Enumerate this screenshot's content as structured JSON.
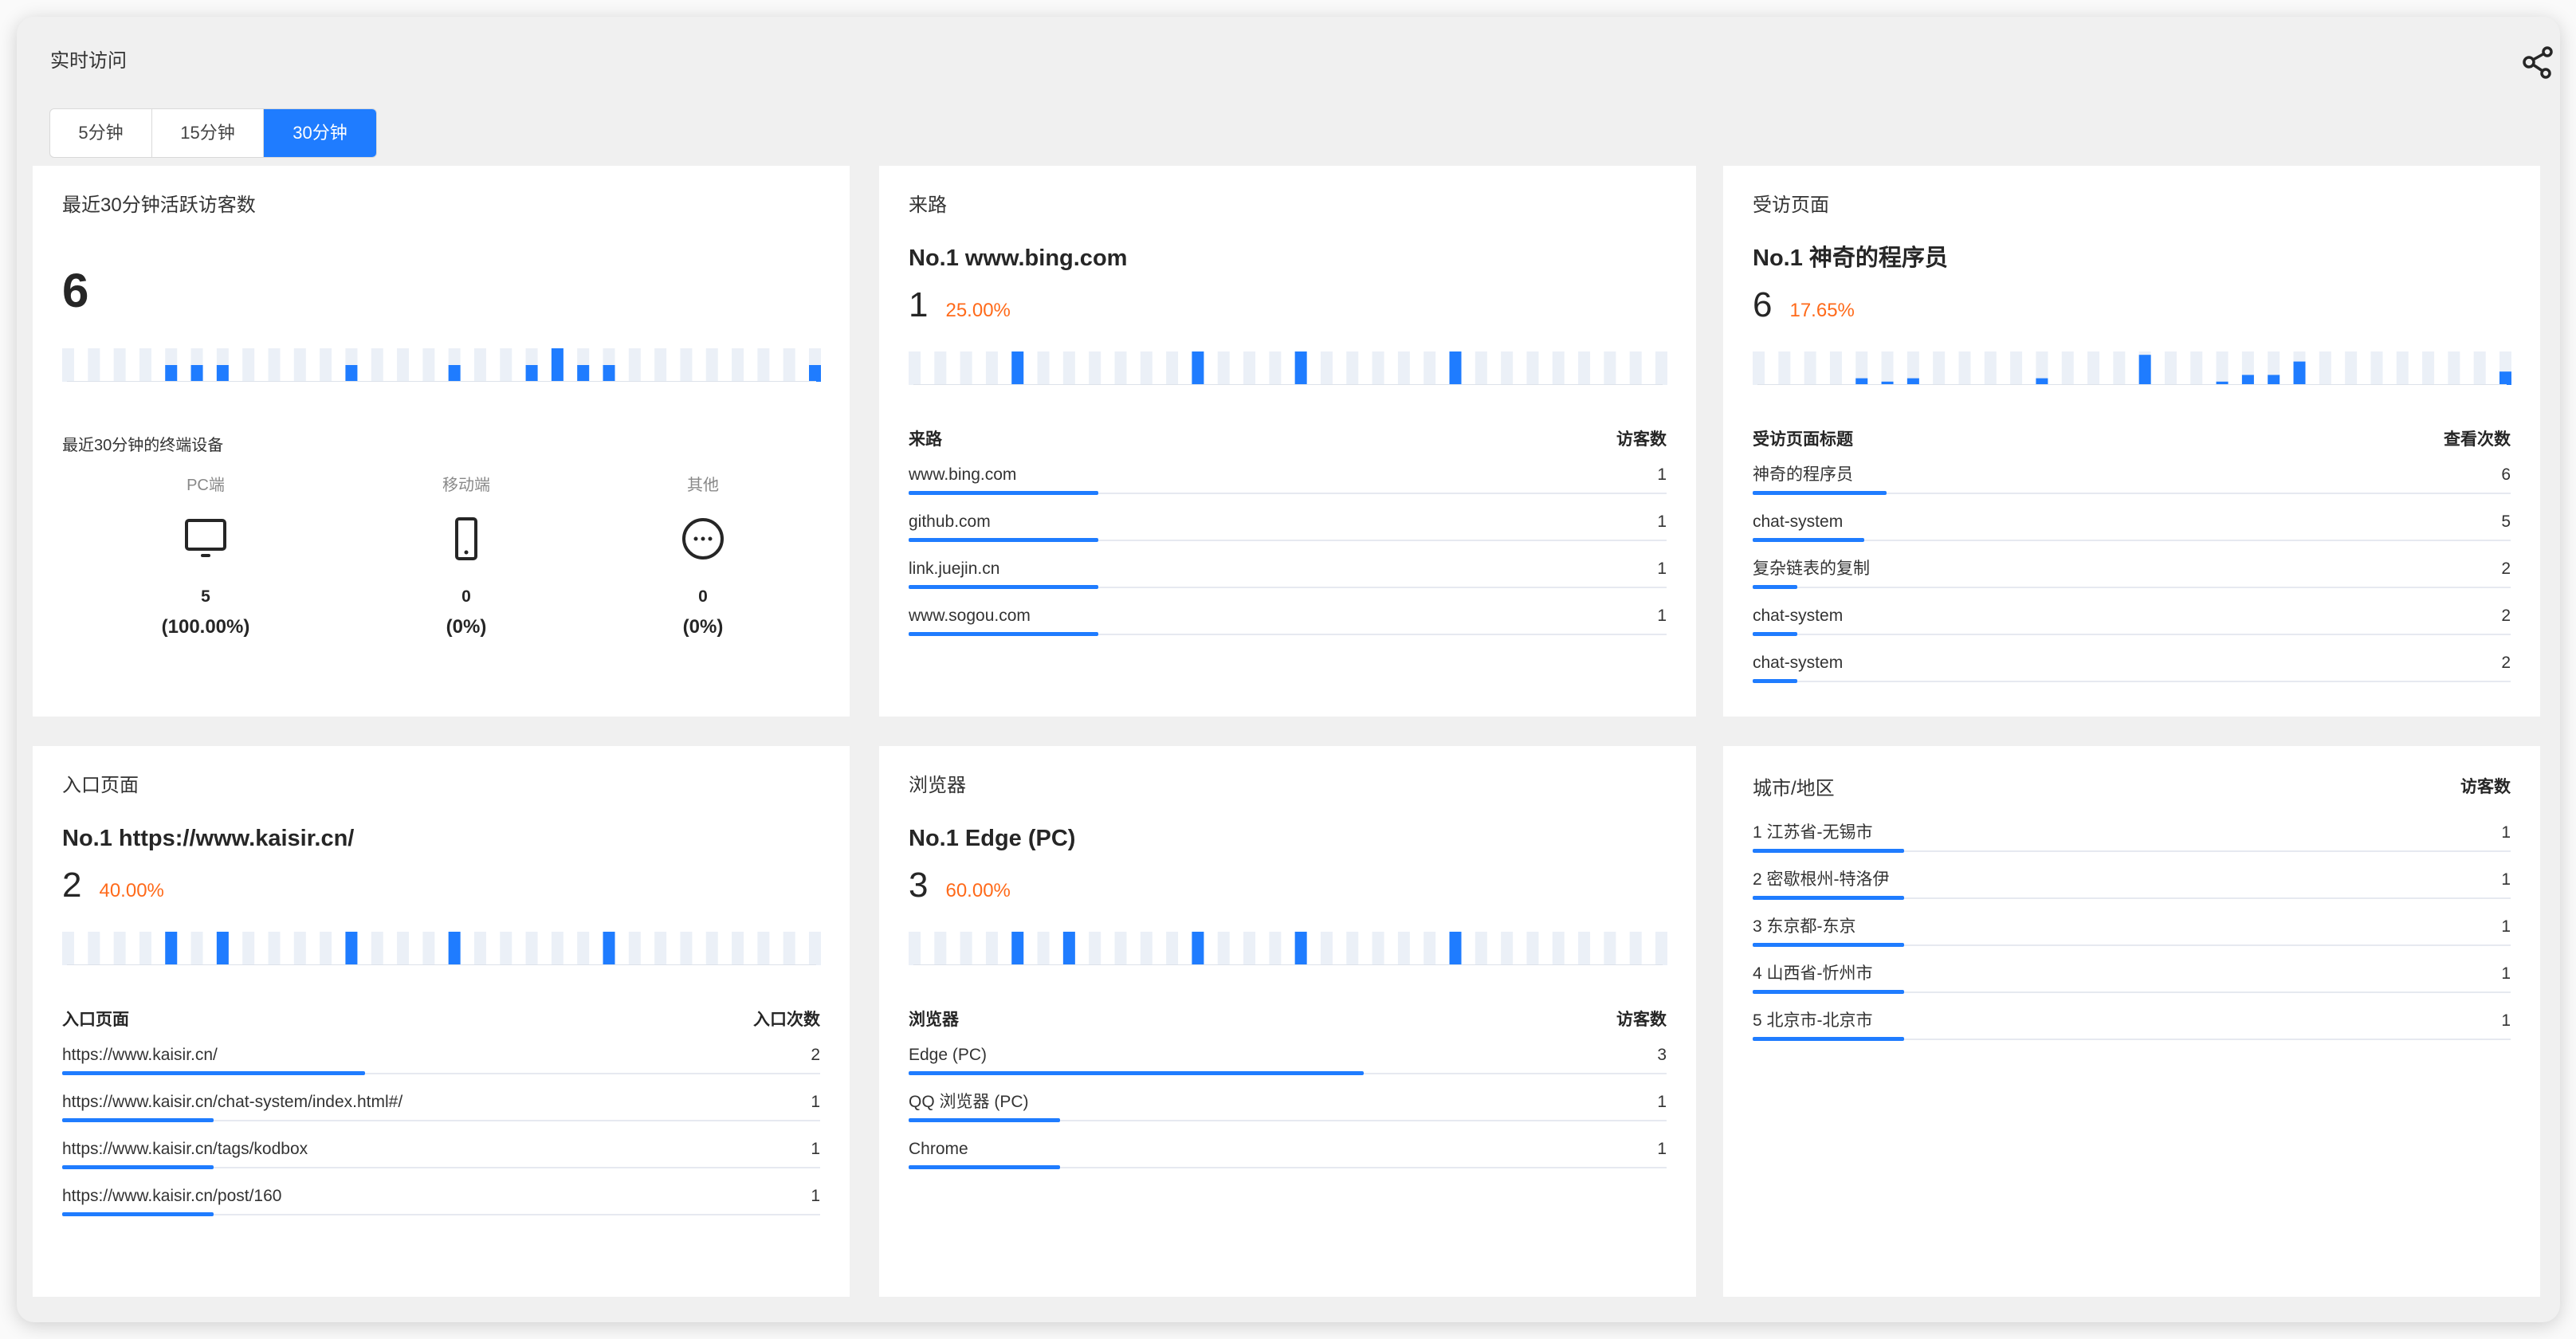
{
  "header": {
    "title": "实时访问",
    "share_icon": "share-icon"
  },
  "tabs": [
    {
      "label": "5分钟",
      "active": false
    },
    {
      "label": "15分钟",
      "active": false
    },
    {
      "label": "30分钟",
      "active": true
    }
  ],
  "colors": {
    "accent": "#1f7cff",
    "bar_bg": "#ebf0f7",
    "percent": "#ff6a1a"
  },
  "active_visitors": {
    "title": "最近30分钟活跃访客数",
    "count": "6",
    "sparkline": {
      "type": "bar",
      "ymax": 2,
      "values": [
        0,
        0,
        0,
        0,
        1,
        1,
        1,
        0,
        0,
        0,
        0,
        1,
        0,
        0,
        0,
        1,
        0,
        0,
        1,
        2,
        1,
        1,
        0,
        0,
        0,
        0,
        0,
        0,
        0,
        1
      ]
    },
    "devices_title": "最近30分钟的终端设备",
    "devices": [
      {
        "label": "PC端",
        "icon": "monitor-icon",
        "count": "5",
        "percent": "(100.00%)"
      },
      {
        "label": "移动端",
        "icon": "phone-icon",
        "count": "0",
        "percent": "(0%)"
      },
      {
        "label": "其他",
        "icon": "more-circle-icon",
        "count": "0",
        "percent": "(0%)"
      }
    ]
  },
  "referrers": {
    "title": "来路",
    "top": "No.1 www.bing.com",
    "top_count": "1",
    "top_percent": "25.00%",
    "sparkline": {
      "type": "bar",
      "ymax": 1,
      "values": [
        0,
        0,
        0,
        0,
        1,
        0,
        0,
        0,
        0,
        0,
        0,
        1,
        0,
        0,
        0,
        1,
        0,
        0,
        0,
        0,
        0,
        1,
        0,
        0,
        0,
        0,
        0,
        0,
        0,
        0
      ]
    },
    "col_label": "来路",
    "col_value": "访客数",
    "rows": [
      {
        "label": "www.bing.com",
        "value": "1",
        "share": 0.25
      },
      {
        "label": "github.com",
        "value": "1",
        "share": 0.25
      },
      {
        "label": "link.juejin.cn",
        "value": "1",
        "share": 0.25
      },
      {
        "label": "www.sogou.com",
        "value": "1",
        "share": 0.25
      }
    ]
  },
  "pages": {
    "title": "受访页面",
    "top": "No.1 神奇的程序员",
    "top_count": "6",
    "top_percent": "17.65%",
    "sparkline": {
      "type": "bar",
      "ymax": 10,
      "values": [
        0,
        0,
        0,
        0,
        2,
        1,
        2,
        0,
        0,
        0,
        0,
        2,
        0,
        0,
        0,
        9,
        0,
        0,
        1,
        3,
        3,
        7,
        0,
        0,
        0,
        0,
        0,
        0,
        0,
        4
      ]
    },
    "col_label": "受访页面标题",
    "col_value": "查看次数",
    "rows": [
      {
        "label": "神奇的程序员",
        "value": "6",
        "share": 0.1765
      },
      {
        "label": "chat-system",
        "value": "5",
        "share": 0.147
      },
      {
        "label": "复杂链表的复制",
        "value": "2",
        "share": 0.059
      },
      {
        "label": "chat-system",
        "value": "2",
        "share": 0.059
      },
      {
        "label": "chat-system",
        "value": "2",
        "share": 0.059
      }
    ]
  },
  "entries": {
    "title": "入口页面",
    "top": "No.1 https://www.kaisir.cn/",
    "top_count": "2",
    "top_percent": "40.00%",
    "sparkline": {
      "type": "bar",
      "ymax": 1,
      "values": [
        0,
        0,
        0,
        0,
        1,
        0,
        1,
        0,
        0,
        0,
        0,
        1,
        0,
        0,
        0,
        1,
        0,
        0,
        0,
        0,
        0,
        1,
        0,
        0,
        0,
        0,
        0,
        0,
        0,
        0
      ]
    },
    "col_label": "入口页面",
    "col_value": "入口次数",
    "rows": [
      {
        "label": "https://www.kaisir.cn/",
        "value": "2",
        "share": 0.4
      },
      {
        "label": "https://www.kaisir.cn/chat-system/index.html#/",
        "value": "1",
        "share": 0.2
      },
      {
        "label": "https://www.kaisir.cn/tags/kodbox",
        "value": "1",
        "share": 0.2
      },
      {
        "label": "https://www.kaisir.cn/post/160",
        "value": "1",
        "share": 0.2
      }
    ]
  },
  "browsers": {
    "title": "浏览器",
    "top": "No.1 Edge (PC)",
    "top_count": "3",
    "top_percent": "60.00%",
    "sparkline": {
      "type": "bar",
      "ymax": 1,
      "values": [
        0,
        0,
        0,
        0,
        1,
        0,
        1,
        0,
        0,
        0,
        0,
        1,
        0,
        0,
        0,
        1,
        0,
        0,
        0,
        0,
        0,
        1,
        0,
        0,
        0,
        0,
        0,
        0,
        0,
        0
      ]
    },
    "col_label": "浏览器",
    "col_value": "访客数",
    "rows": [
      {
        "label": "Edge (PC)",
        "value": "3",
        "share": 0.6
      },
      {
        "label": "QQ 浏览器 (PC)",
        "value": "1",
        "share": 0.2
      },
      {
        "label": "Chrome",
        "value": "1",
        "share": 0.2
      }
    ]
  },
  "cities": {
    "col_label": "城市/地区",
    "col_value": "访客数",
    "rows": [
      {
        "label": "1 江苏省-无锡市",
        "value": "1",
        "share": 0.2
      },
      {
        "label": "2 密歇根州-特洛伊",
        "value": "1",
        "share": 0.2
      },
      {
        "label": "3 东京都-东京",
        "value": "1",
        "share": 0.2
      },
      {
        "label": "4 山西省-忻州市",
        "value": "1",
        "share": 0.2
      },
      {
        "label": "5 北京市-北京市",
        "value": "1",
        "share": 0.2
      }
    ]
  }
}
